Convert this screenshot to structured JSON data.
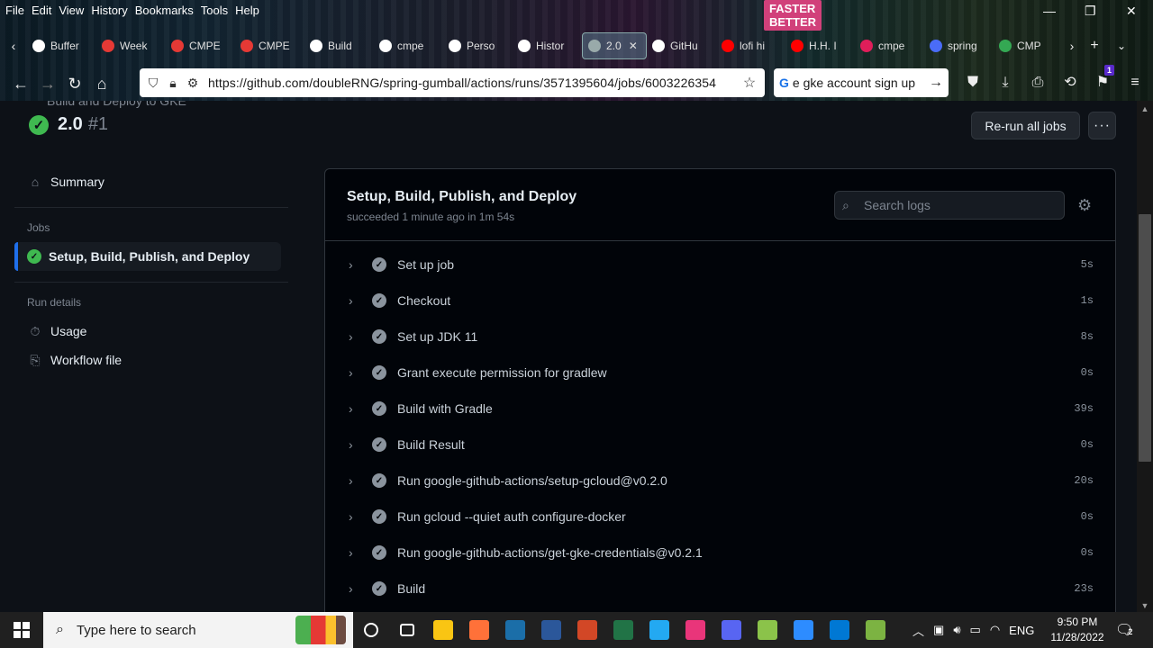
{
  "browser": {
    "menu": [
      "File",
      "Edit",
      "View",
      "History",
      "Bookmarks",
      "Tools",
      "Help"
    ],
    "banner_text": "FASTER BETTER",
    "window_controls": {
      "minimize": "—",
      "restore": "❐",
      "close": "✕"
    },
    "tabs": [
      {
        "label": "Buffer",
        "color": "#ffffff"
      },
      {
        "label": "Week",
        "color": "#e53935"
      },
      {
        "label": "CMPE",
        "color": "#e53935"
      },
      {
        "label": "CMPE",
        "color": "#e53935"
      },
      {
        "label": "Build",
        "color": "#ffffff"
      },
      {
        "label": "cmpe",
        "color": "#ffffff"
      },
      {
        "label": "Perso",
        "color": "#ffffff"
      },
      {
        "label": "Histor",
        "color": "#ffffff"
      },
      {
        "label": "2.0",
        "color": "#9aa",
        "active": true
      },
      {
        "label": "GitHu",
        "color": "#ffffff"
      },
      {
        "label": "lofi hi",
        "color": "#ff0000"
      },
      {
        "label": "H.H. I",
        "color": "#ff0000"
      },
      {
        "label": "cmpe",
        "color": "#e01e5a"
      },
      {
        "label": "spring",
        "color": "#4a6cf7"
      },
      {
        "label": "CMP",
        "color": "#34a853"
      }
    ],
    "url": "https://github.com/doubleRNG/spring-gumball/actions/runs/3571395604/jobs/6003226354",
    "search_value": "e gke account sign up",
    "notification_count": "1"
  },
  "page": {
    "workflow_name": "Build and Deploy to GKE",
    "run_version": "2.0",
    "run_number": "#1",
    "rerun_label": "Re-run all jobs",
    "more_label": "···"
  },
  "sidebar": {
    "summary": "Summary",
    "jobs_heading": "Jobs",
    "active_job": "Setup, Build, Publish, and Deploy",
    "run_details_heading": "Run details",
    "usage": "Usage",
    "workflow_file": "Workflow file"
  },
  "job": {
    "title": "Setup, Build, Publish, and Deploy",
    "subtitle": "succeeded 1 minute ago in 1m 54s",
    "search_placeholder": "Search logs",
    "steps": [
      {
        "name": "Set up job",
        "duration": "5s"
      },
      {
        "name": "Checkout",
        "duration": "1s"
      },
      {
        "name": "Set up JDK 11",
        "duration": "8s"
      },
      {
        "name": "Grant execute permission for gradlew",
        "duration": "0s"
      },
      {
        "name": "Build with Gradle",
        "duration": "39s"
      },
      {
        "name": "Build Result",
        "duration": "0s"
      },
      {
        "name": "Run google-github-actions/setup-gcloud@v0.2.0",
        "duration": "20s"
      },
      {
        "name": "Run gcloud --quiet auth configure-docker",
        "duration": "0s"
      },
      {
        "name": "Run google-github-actions/get-gke-credentials@v0.2.1",
        "duration": "0s"
      },
      {
        "name": "Build",
        "duration": "23s"
      }
    ]
  },
  "taskbar": {
    "search_placeholder": "Type here to search",
    "apps": [
      {
        "name": "cortana",
        "color": "#ffffff"
      },
      {
        "name": "task-view",
        "color": "#ffffff"
      },
      {
        "name": "file-explorer",
        "color": "#f9c513"
      },
      {
        "name": "firefox",
        "color": "#ff7139"
      },
      {
        "name": "steam",
        "color": "#1b6ea8"
      },
      {
        "name": "word",
        "color": "#2b579a"
      },
      {
        "name": "powerpoint",
        "color": "#d24726"
      },
      {
        "name": "excel",
        "color": "#217346"
      },
      {
        "name": "vscode",
        "color": "#23a9f2"
      },
      {
        "name": "intellij",
        "color": "#e9357a"
      },
      {
        "name": "discord",
        "color": "#5865f2"
      },
      {
        "name": "paint",
        "color": "#8bc34a"
      },
      {
        "name": "zoom",
        "color": "#2d8cff"
      },
      {
        "name": "photos",
        "color": "#0078d4"
      },
      {
        "name": "notepad",
        "color": "#7cb342"
      }
    ],
    "language": "ENG",
    "time": "9:50 PM",
    "date": "11/28/2022",
    "notifications": "2"
  }
}
